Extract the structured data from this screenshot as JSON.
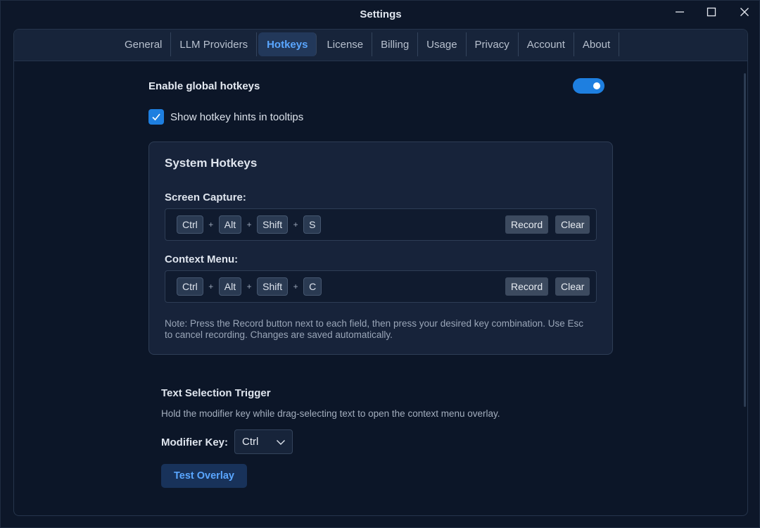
{
  "window": {
    "title": "Settings"
  },
  "tabs": [
    {
      "label": "General",
      "active": false
    },
    {
      "label": "LLM Providers",
      "active": false
    },
    {
      "label": "Hotkeys",
      "active": true
    },
    {
      "label": "License",
      "active": false
    },
    {
      "label": "Billing",
      "active": false
    },
    {
      "label": "Usage",
      "active": false
    },
    {
      "label": "Privacy",
      "active": false
    },
    {
      "label": "Account",
      "active": false
    },
    {
      "label": "About",
      "active": false
    }
  ],
  "global": {
    "enable_label": "Enable global hotkeys",
    "enabled": true,
    "hints_label": "Show hotkey hints in tooltips",
    "hints_checked": true
  },
  "system_hotkeys": {
    "title": "System Hotkeys",
    "screen_capture": {
      "label": "Screen Capture:",
      "keys": [
        "Ctrl",
        "Alt",
        "Shift",
        "S"
      ]
    },
    "context_menu": {
      "label": "Context Menu:",
      "keys": [
        "Ctrl",
        "Alt",
        "Shift",
        "C"
      ]
    },
    "separator": "+",
    "record_label": "Record",
    "clear_label": "Clear",
    "note": "Note: Press the Record button next to each field, then press your desired key combination. Use Esc to cancel recording. Changes are saved automatically."
  },
  "text_selection": {
    "title": "Text Selection Trigger",
    "description": "Hold the modifier key while drag-selecting text to open the context menu overlay.",
    "modifier_label": "Modifier Key:",
    "modifier_value": "Ctrl",
    "test_button": "Test Overlay"
  },
  "colors": {
    "accent": "#1e7fe0",
    "active_tab_text": "#5aa6ff",
    "background": "#0c1628",
    "card": "#17233a"
  }
}
